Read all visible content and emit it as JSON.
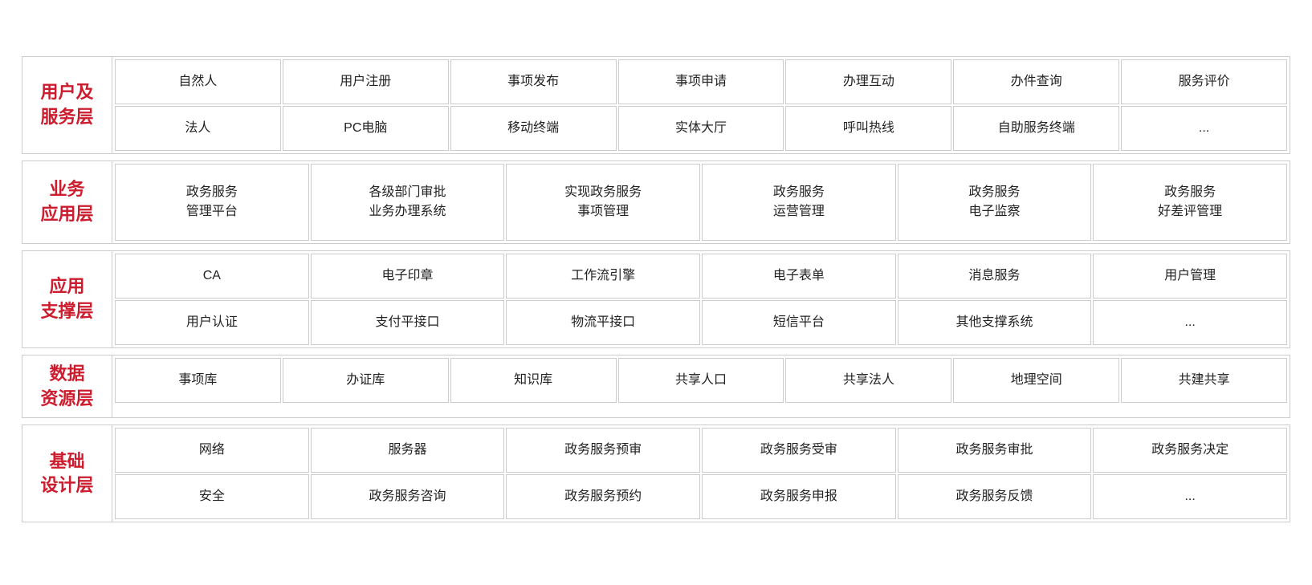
{
  "layers": [
    {
      "id": "user-service",
      "label": "用户及\n服务层",
      "gridClass": "grid-usr",
      "cells": [
        {
          "text": "自然人",
          "row": 1,
          "col": 1
        },
        {
          "text": "用户注册",
          "row": 1,
          "col": 2
        },
        {
          "text": "事项发布",
          "row": 1,
          "col": 3
        },
        {
          "text": "事项申请",
          "row": 1,
          "col": 4
        },
        {
          "text": "办理互动",
          "row": 1,
          "col": 5
        },
        {
          "text": "办件查询",
          "row": 1,
          "col": 6
        },
        {
          "text": "服务评价",
          "row": 1,
          "col": 7
        },
        {
          "text": "法人",
          "row": 2,
          "col": 1
        },
        {
          "text": "PC电脑",
          "row": 2,
          "col": 2
        },
        {
          "text": "移动终端",
          "row": 2,
          "col": 3
        },
        {
          "text": "实体大厅",
          "row": 2,
          "col": 4
        },
        {
          "text": "呼叫热线",
          "row": 2,
          "col": 5
        },
        {
          "text": "自助服务终端",
          "row": 2,
          "col": 6
        },
        {
          "text": "...",
          "row": 2,
          "col": 7
        }
      ]
    },
    {
      "id": "biz-app",
      "label": "业务\n应用层",
      "gridClass": "grid-biz",
      "cells": [
        {
          "text": "政务服务\n管理平台"
        },
        {
          "text": "各级部门审批\n业务办理系统"
        },
        {
          "text": "实现政务服务\n事项管理"
        },
        {
          "text": "政务服务\n运营管理"
        },
        {
          "text": "政务服务\n电子监察"
        },
        {
          "text": "政务服务\n好差评管理"
        }
      ]
    },
    {
      "id": "app-support",
      "label": "应用\n支撑层",
      "gridClass": "grid-app",
      "cells": [
        {
          "text": "CA"
        },
        {
          "text": "电子印章"
        },
        {
          "text": "工作流引擎"
        },
        {
          "text": "电子表单"
        },
        {
          "text": "消息服务"
        },
        {
          "text": "用户管理"
        },
        {
          "text": "用户认证"
        },
        {
          "text": "支付平接口"
        },
        {
          "text": "物流平接口"
        },
        {
          "text": "短信平台"
        },
        {
          "text": "其他支撑系统"
        },
        {
          "text": "..."
        }
      ]
    },
    {
      "id": "data-resource",
      "label": "数据\n资源层",
      "gridClass": "grid-data",
      "cells": [
        {
          "text": "事项库"
        },
        {
          "text": "办证库"
        },
        {
          "text": "知识库"
        },
        {
          "text": "共享人口"
        },
        {
          "text": "共享法人"
        },
        {
          "text": "地理空间"
        },
        {
          "text": "共建共享"
        }
      ]
    },
    {
      "id": "infrastructure",
      "label": "基础\n设计层",
      "gridClass": "grid-infra",
      "cells": [
        {
          "text": "网络"
        },
        {
          "text": "服务器"
        },
        {
          "text": "政务服务预审"
        },
        {
          "text": "政务服务受审"
        },
        {
          "text": "政务服务审批"
        },
        {
          "text": "政务服务决定"
        },
        {
          "text": "安全"
        },
        {
          "text": "政务服务咨询"
        },
        {
          "text": "政务服务预约"
        },
        {
          "text": "政务服务申报"
        },
        {
          "text": "政务服务反馈"
        },
        {
          "text": "..."
        }
      ]
    }
  ]
}
